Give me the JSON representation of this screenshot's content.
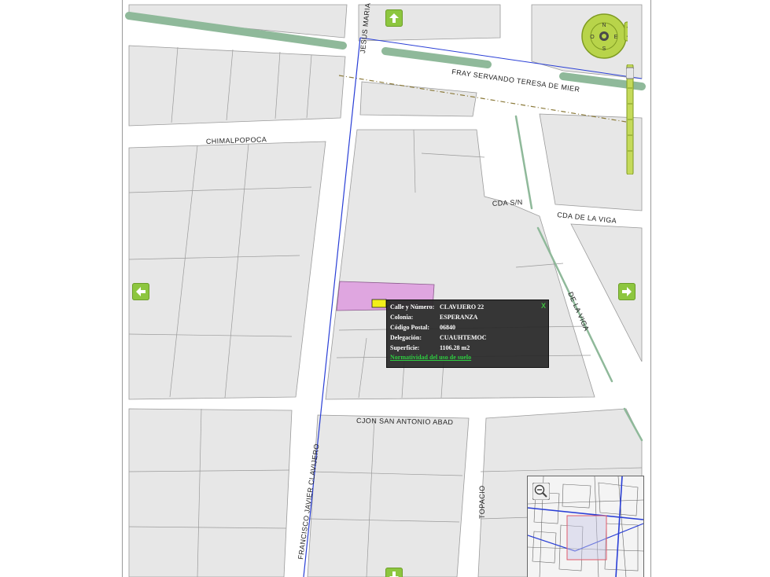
{
  "map": {
    "streets": {
      "jesus_maria": "JESUS MARIA",
      "fray_servando": "FRAY SERVANDO TERESA DE MIER",
      "chimalpopoca": "CHIMALPOPOCA",
      "cda_sn": "CDA S/N",
      "cda_de_la_viga": "CDA DE LA VIGA",
      "de_la_viga": "DE LA VIGA",
      "cjon_san_antonio_abad": "CJON SAN ANTONIO ABAD",
      "francisco_javier_clavijero": "FRANCISCO JAVIER CLAVIJERO",
      "topacio": "TOPACIO"
    },
    "compass": {
      "n": "N",
      "s": "S",
      "e": "E",
      "o": "O"
    },
    "colors": {
      "road": "#ffffff",
      "block": "#e7e7e7",
      "block_outline": "#9a9a9a",
      "green_strip": "#8fb99a",
      "blue_line": "#2a3fd6",
      "selected_parcel": "#dfa6e0",
      "nav_green": "#8dc63f"
    }
  },
  "popup": {
    "rows": [
      {
        "key": "Calle y Número:",
        "value": "CLAVIJERO 22"
      },
      {
        "key": "Colonia:",
        "value": "ESPERANZA"
      },
      {
        "key": "Código Postal:",
        "value": "06840"
      },
      {
        "key": "Delegación:",
        "value": "CUAUHTEMOC"
      },
      {
        "key": "Superficie:",
        "value": "1106.28 m2"
      }
    ],
    "link": "Normatividad del uso de suelo",
    "close": "X"
  },
  "icons": {
    "nav_up": "arrow-up-icon",
    "nav_down": "arrow-down-icon",
    "nav_left": "arrow-left-icon",
    "nav_right": "arrow-right-icon",
    "zoom_out": "magnifier-minus-icon",
    "marker": "flag-marker-icon"
  }
}
